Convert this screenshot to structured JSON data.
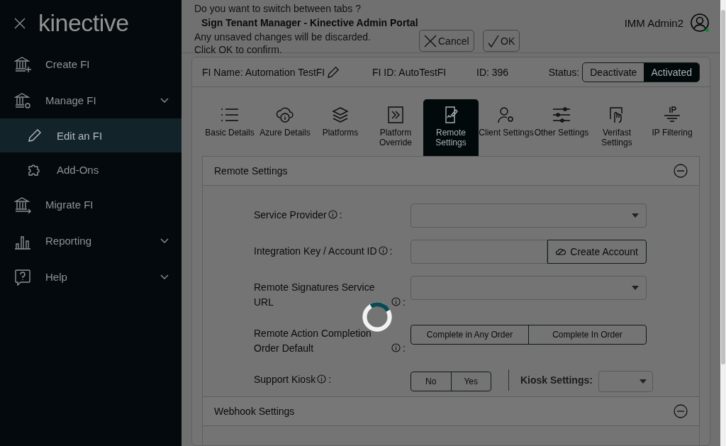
{
  "sidebar": {
    "logo": "kinective",
    "items": [
      {
        "label": "Create FI",
        "expandable": false
      },
      {
        "label": "Manage FI",
        "expandable": true,
        "children": [
          {
            "label": "Edit an FI",
            "selected": true
          },
          {
            "label": "Add-Ons",
            "selected": false
          }
        ]
      },
      {
        "label": "Migrate FI",
        "expandable": false
      },
      {
        "label": "Reporting",
        "expandable": true
      },
      {
        "label": "Help",
        "expandable": true
      }
    ]
  },
  "header": {
    "title": "Sign Tenant Manager - Kinective Admin Portal",
    "user": "IMM Admin2",
    "user_online": true
  },
  "dialog": {
    "lines": [
      "Do you want to switch between tabs ?",
      "Any unsaved changes will be discarded.",
      "Click OK to confirm."
    ],
    "buttons": [
      {
        "label": "Cancel",
        "kind": "cancel"
      },
      {
        "label": "OK",
        "kind": "ok"
      }
    ]
  },
  "fi_info": {
    "name": "FI Name: Automation TestFI",
    "fi_id": "FI ID: AutoTestFI",
    "id": "ID: 396",
    "status_label": "Status:",
    "status_options": [
      {
        "label": "Deactivate",
        "selected": false
      },
      {
        "label": "Activated",
        "selected": true
      }
    ]
  },
  "tabs": [
    {
      "label": "Basic Details",
      "selected": false
    },
    {
      "label": "Azure Details",
      "selected": false
    },
    {
      "label": "Platforms",
      "selected": false
    },
    {
      "label": "Platform Override",
      "selected": false
    },
    {
      "label": "Remote Settings",
      "selected": true
    },
    {
      "label": "Client Settings",
      "selected": false
    },
    {
      "label": "Other Settings",
      "selected": false
    },
    {
      "label": "Verifast Settings",
      "selected": false
    },
    {
      "label": "IP Filtering",
      "selected": false
    }
  ],
  "sections": [
    {
      "title": "Remote Settings",
      "expanded": true,
      "fields": [
        {
          "kind": "select",
          "label": "Service Provider",
          "suffix": ":"
        },
        {
          "kind": "input_button",
          "label": "Integration Key / Account ID",
          "suffix": ":",
          "button": "Create Account"
        },
        {
          "kind": "select",
          "label": "Remote Signatures Service URL",
          "suffix": ":"
        },
        {
          "kind": "segmented",
          "label": "Remote Action Completion Order Default",
          "suffix": ":",
          "options": [
            {
              "label": "Complete in Any Order",
              "selected": false
            },
            {
              "label": "Complete In Order",
              "selected": false
            }
          ]
        },
        {
          "kind": "kiosk",
          "label": "Support Kiosk",
          "suffix": ":",
          "options": [
            {
              "label": "No",
              "selected": false
            },
            {
              "label": "Yes",
              "selected": false
            }
          ],
          "extra_label": "Kiosk Settings:"
        }
      ]
    },
    {
      "title": "Webhook Settings",
      "expanded": true
    }
  ],
  "loading": true
}
